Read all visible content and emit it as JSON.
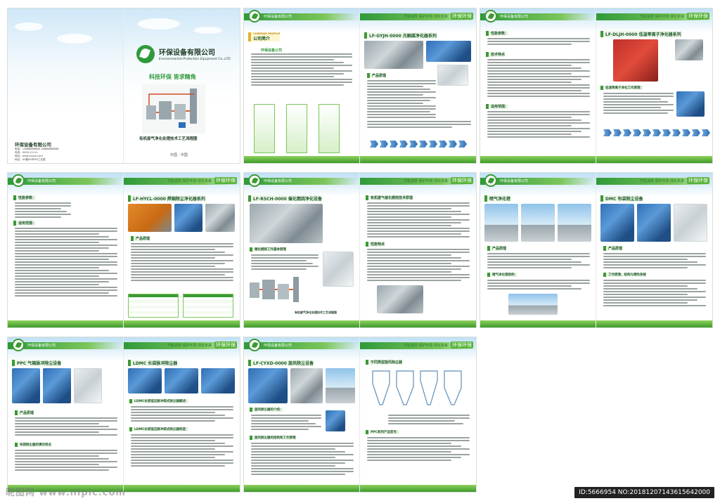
{
  "brochure": {
    "company_cn": "环保设备有限公司",
    "company_en": "Environmental Protection Equipment Co.,LTD",
    "slogan": "科技环保  皆求精角",
    "cover_caption": "有机废气净化处理技术工艺流程图",
    "cover_city": "中国 · 中国",
    "cover_company": "环保设备有限公司",
    "cover_contact": [
      "电话：13888888888  18888888888",
      "传真：0000-11111",
      "网址：www.xxxxx.com",
      "地址：XX路XX号XX工业园"
    ],
    "header": {
      "company": "环保设备有限公司",
      "slogan": "节能减排  保护环境  绿化未来",
      "brand": "环保环保"
    },
    "pages": {
      "p2_title": "公司简介",
      "p2_sub": "COMPANY PROFILE",
      "p2_lead": "环保设备公司",
      "p3_title": "LF-GYJH-0000 光触媒净化器系列",
      "p3_section": "产品原理",
      "p4_params": "性能参数：",
      "p4_tech": "技术特点",
      "p4_scope": "适用范围：",
      "p5_title": "LF-DLJH-0000 低温等离子净化器系列",
      "p5_section": "低温等离子净化工作原理：",
      "p6_params": "性能参数：",
      "p6_scope": "适用范围：",
      "p7_title": "LF-HYCL-0000 焊烟除尘净化器系列",
      "p7_section": "产品原理",
      "p8_title": "LF-RSCH-0000 催化燃烧净化设备",
      "p8_process": "催化燃烧工作基本原理",
      "p8_caption": "有机废气净化处理技术工艺流程图",
      "p9_section": "有机废气催化燃烧技术原理",
      "p9_feature": "性能特点",
      "p10_title": "喷气净化塔",
      "p10_section": "产品原理",
      "p10_sub": "喷气净化塔结构：",
      "p11_title": "DMC 布袋除尘设备",
      "p11_section": "产品原理",
      "p11_sub": "工作原理、结构与喷吹系统",
      "p12_title": "PPC 气箱脉冲除尘设备",
      "p12_section": "产品原理",
      "p12_sub": "布袋除尘器的清灰特点",
      "p13_title": "LDMC 长袋脉冲除尘器",
      "p13_sub1": "LDMC长袋低压脉冲袋式除尘器概述：",
      "p13_sub2": "LDMC长袋低压脉冲袋式除尘器构造：",
      "p14_title": "LF-CYXD-0000 旋风除尘设备",
      "p14_sub1": "旋风除尘器的介绍：",
      "p14_sub2": "旋风除尘器的结构和工作原理",
      "p15_title": "不同类型旋风除尘器",
      "p15_sub": "PPC系列产品型号：",
      "footer": "环保设备"
    }
  },
  "watermark": {
    "site": "昵图网 www.nipic.com",
    "id": "ID:5666954 NO:20181207143615642000"
  }
}
